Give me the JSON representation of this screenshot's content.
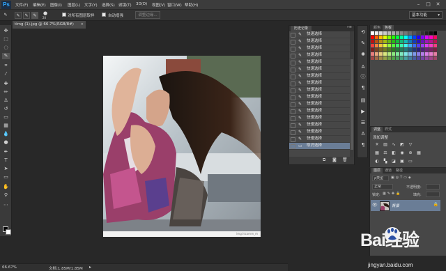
{
  "app": {
    "logo": "Ps"
  },
  "menu": [
    "文件(F)",
    "编辑(E)",
    "图像(I)",
    "图层(L)",
    "文字(Y)",
    "选择(S)",
    "滤镜(T)",
    "3D(D)",
    "视图(V)",
    "窗口(W)",
    "帮助(H)"
  ],
  "window_controls": [
    "–",
    "□",
    "✕"
  ],
  "options_bar": {
    "brush_size": "20",
    "sample_all_layers": "对所有图层取样",
    "auto_enhance": "自动增强",
    "refine_edge": "调整边缘...",
    "workspace": "基本功能"
  },
  "document": {
    "tab": "timg (1).jpg @ 66.7%(RGB/8#)"
  },
  "image": {
    "watermark": "img.hicomm_m"
  },
  "status": {
    "zoom": "66.67%",
    "doc": "文档:1.85M/1.85M"
  },
  "history": {
    "title": "历史记录",
    "items": [
      "快速选择",
      "快速选择",
      "快速选择",
      "快速选择",
      "快速选择",
      "快速选择",
      "快速选择",
      "快速选择",
      "快速选择",
      "快速选择",
      "快速选择",
      "快速选择",
      "快速选择",
      "快速选择",
      "快速选择",
      "快速选择"
    ],
    "last": "取消选择"
  },
  "color_panel": {
    "tabs": [
      "颜色",
      "色板"
    ]
  },
  "adjust_panel": {
    "tabs": [
      "调整",
      "样式"
    ],
    "title": "添加调整"
  },
  "layers_panel": {
    "tabs": [
      "图层",
      "通道",
      "路径"
    ],
    "kind": "ρ类型",
    "blend": "正常",
    "opacity_label": "不透明度:",
    "lock_label": "锁定:",
    "fill_label": "填充:",
    "layer_name": "背景"
  },
  "watermark": {
    "brand": "Bai经验",
    "url": "jingyan.baidu.com"
  },
  "colors": {
    "accent": "#6a7d96",
    "panel": "#474747",
    "bg": "#282828"
  }
}
